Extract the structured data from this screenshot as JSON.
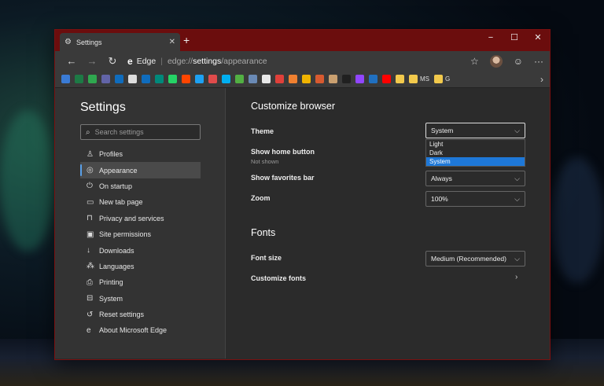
{
  "tab": {
    "title": "Settings",
    "new_tab": "+"
  },
  "window_controls": {
    "minimize": "−",
    "maximize": "☐",
    "close": "✕"
  },
  "toolbar": {
    "back": "←",
    "forward": "→",
    "refresh": "↻",
    "site_name": "Edge",
    "url_prefix": "edge://",
    "url_strong": "settings",
    "url_suffix": "/appearance",
    "favorite": "☆",
    "emoji": "☺",
    "more": "···"
  },
  "favorites_bar": {
    "items": [
      {
        "icon": "cloud-icon",
        "color": "#3a7bd5"
      },
      {
        "icon": "excel-icon",
        "color": "#1d7a45"
      },
      {
        "icon": "game-icon",
        "color": "#2fa84f"
      },
      {
        "icon": "teams-icon",
        "color": "#6264a7"
      },
      {
        "icon": "outlook-icon",
        "color": "#0f6cbd"
      },
      {
        "icon": "page-icon",
        "color": "#dddddd"
      },
      {
        "icon": "outlook-icon",
        "color": "#0f6cbd"
      },
      {
        "icon": "bing-icon",
        "color": "#00897b"
      },
      {
        "icon": "whatsapp-icon",
        "color": "#25d366"
      },
      {
        "icon": "reddit-icon",
        "color": "#ff4500"
      },
      {
        "icon": "twitter-icon",
        "color": "#1da1f2"
      },
      {
        "icon": "chart-icon",
        "color": "#e04b4b"
      },
      {
        "icon": "skype-icon",
        "color": "#00aff0"
      },
      {
        "icon": "xbox-icon",
        "color": "#52b043"
      },
      {
        "icon": "steam-icon",
        "color": "#6a8ab5"
      },
      {
        "icon": "calendar-icon",
        "color": "#e8e8e8"
      },
      {
        "icon": "target-icon",
        "color": "#e0403a"
      },
      {
        "icon": "badge-icon",
        "color": "#f08030"
      },
      {
        "icon": "app-icon",
        "color": "#f0b400"
      },
      {
        "icon": "app-icon",
        "color": "#d85a30"
      },
      {
        "icon": "puzzle-icon",
        "color": "#caa070"
      },
      {
        "icon": "lego-icon",
        "color": "#202020"
      },
      {
        "icon": "twitch-icon",
        "color": "#9146ff"
      },
      {
        "icon": "code-icon",
        "color": "#2070c0"
      },
      {
        "icon": "youtube-icon",
        "color": "#ff0000"
      },
      {
        "icon": "folder-icon",
        "color": "#f2c94c"
      }
    ],
    "labeled": [
      {
        "label": "MS",
        "icon": "folder-icon",
        "color": "#f2c94c"
      },
      {
        "label": "G",
        "icon": "folder-icon",
        "color": "#f2c94c"
      }
    ],
    "overflow": "›"
  },
  "sidebar": {
    "title": "Settings",
    "search_placeholder": "Search settings",
    "items": [
      {
        "label": "Profiles",
        "icon": "person-icon",
        "glyph": "♙"
      },
      {
        "label": "Appearance",
        "icon": "palette-icon",
        "glyph": "◎"
      },
      {
        "label": "On startup",
        "icon": "power-icon",
        "glyph": "⏻"
      },
      {
        "label": "New tab page",
        "icon": "tab-page-icon",
        "glyph": "▭"
      },
      {
        "label": "Privacy and services",
        "icon": "lock-icon",
        "glyph": "⊓"
      },
      {
        "label": "Site permissions",
        "icon": "permissions-icon",
        "glyph": "▣"
      },
      {
        "label": "Downloads",
        "icon": "download-icon",
        "glyph": "↓"
      },
      {
        "label": "Languages",
        "icon": "languages-icon",
        "glyph": "⁂"
      },
      {
        "label": "Printing",
        "icon": "printer-icon",
        "glyph": "⎙"
      },
      {
        "label": "System",
        "icon": "laptop-icon",
        "glyph": "⊟"
      },
      {
        "label": "Reset settings",
        "icon": "reset-icon",
        "glyph": "↺"
      },
      {
        "label": "About Microsoft Edge",
        "icon": "edge-icon",
        "glyph": "e"
      }
    ],
    "active_index": 1
  },
  "main": {
    "customize_heading": "Customize browser",
    "theme": {
      "label": "Theme",
      "value": "System",
      "options": [
        "Light",
        "Dark",
        "System"
      ],
      "selected": "System"
    },
    "home_button": {
      "label": "Show home button",
      "sub": "Not shown"
    },
    "favorites_bar": {
      "label": "Show favorites bar",
      "value": "Always"
    },
    "zoom": {
      "label": "Zoom",
      "value": "100%"
    },
    "fonts_heading": "Fonts",
    "font_size": {
      "label": "Font size",
      "value": "Medium (Recommended)"
    },
    "customize_fonts": {
      "label": "Customize fonts"
    }
  }
}
